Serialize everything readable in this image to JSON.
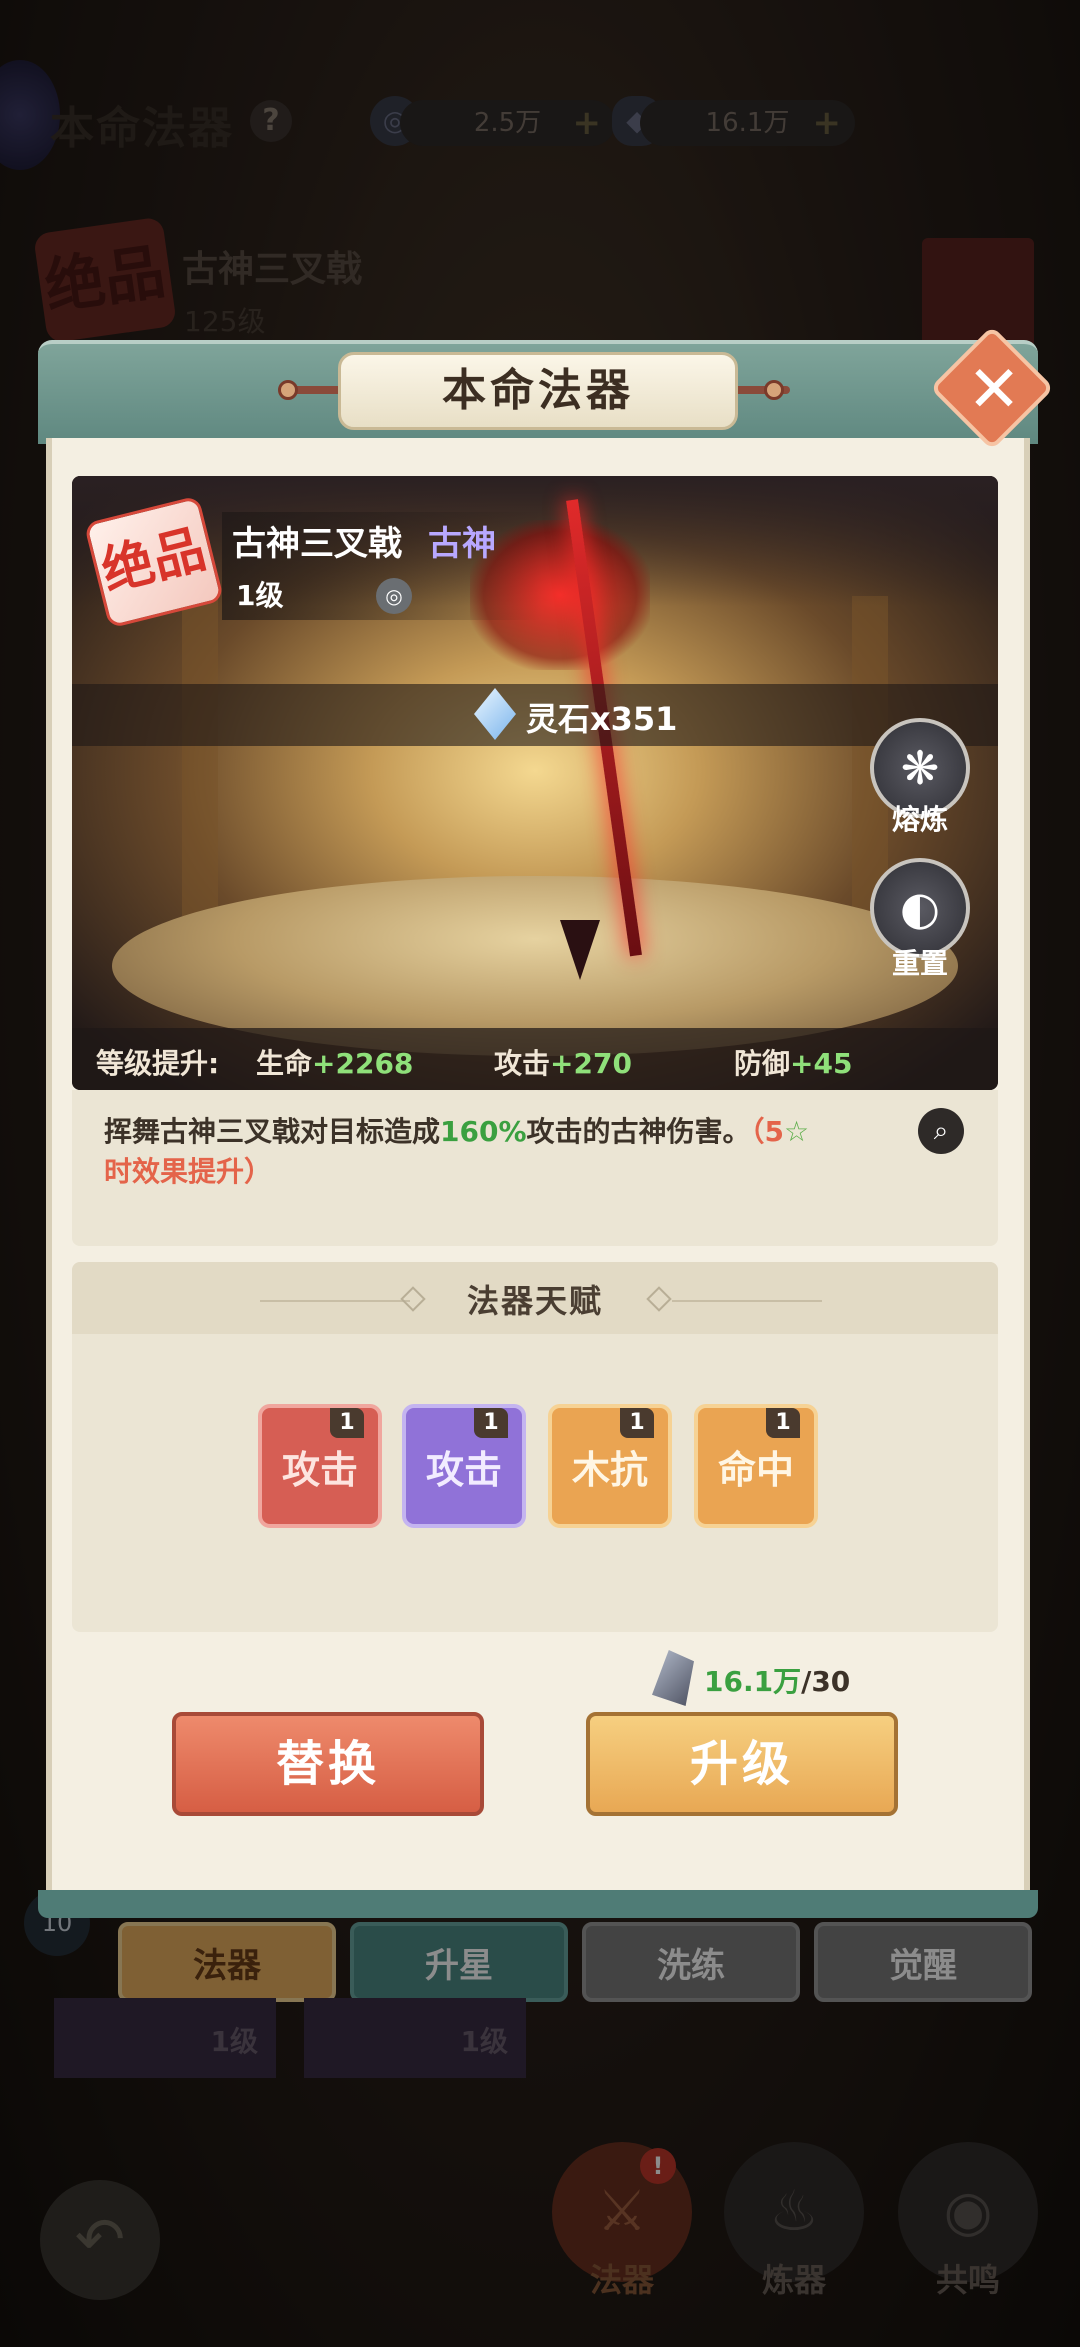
{
  "background": {
    "title": "本命法器",
    "help": "?",
    "resources": [
      {
        "name": "spirit-coin",
        "value": "2.5万",
        "plus": "+"
      },
      {
        "name": "ore",
        "value": "16.1万",
        "plus": "+"
      }
    ],
    "item_rarity": "绝品",
    "item_name": "古神三叉戟",
    "item_level": "125级",
    "tabs": [
      "法器",
      "升星",
      "洗练",
      "觉醒"
    ],
    "slot_badge": "10",
    "slot_levels": [
      "1级",
      "1级"
    ],
    "nav": [
      {
        "label": "法器",
        "active": true
      },
      {
        "label": "炼器",
        "active": false
      },
      {
        "label": "共鸣",
        "active": false
      }
    ],
    "nav_badge": "!"
  },
  "modal": {
    "title": "本命法器",
    "close": "✕",
    "weapon": {
      "rarity": "绝品",
      "name": "古神三叉戟",
      "tag": "古神",
      "level": "1级",
      "lock": "🔓",
      "cost": "灵石x351"
    },
    "side_buttons": [
      {
        "icon": "smelt-icon",
        "label": "熔炼"
      },
      {
        "icon": "reset-icon",
        "label": "重置"
      }
    ],
    "level_up": {
      "label": "等级提升:",
      "stats": [
        {
          "name": "生命",
          "value": "+2268"
        },
        {
          "name": "攻击",
          "value": "+270"
        },
        {
          "name": "防御",
          "value": "+45"
        }
      ]
    },
    "description": {
      "text_a": "挥舞古神三叉戟对目标造成",
      "pct": "160%",
      "text_b": "攻击的古神伤害。",
      "hint_a": "（5",
      "star": "☆",
      "hint_b": "时效果提升）"
    },
    "talent": {
      "title": "法器天赋",
      "chips": [
        {
          "label": "攻击",
          "count": "1",
          "color": "red"
        },
        {
          "label": "攻击",
          "count": "1",
          "color": "purple"
        },
        {
          "label": "木抗",
          "count": "1",
          "color": "orange"
        },
        {
          "label": "命中",
          "count": "1",
          "color": "orange"
        }
      ]
    },
    "upgrade_cost": {
      "have": "16.1万",
      "need": "/30"
    },
    "buttons": {
      "replace": "替换",
      "upgrade": "升级"
    }
  },
  "colors": {
    "header_teal": "#5f8880",
    "panel_cream": "#f4efe2",
    "green_value": "#3aa040",
    "rarity_red": "#d8342a"
  }
}
